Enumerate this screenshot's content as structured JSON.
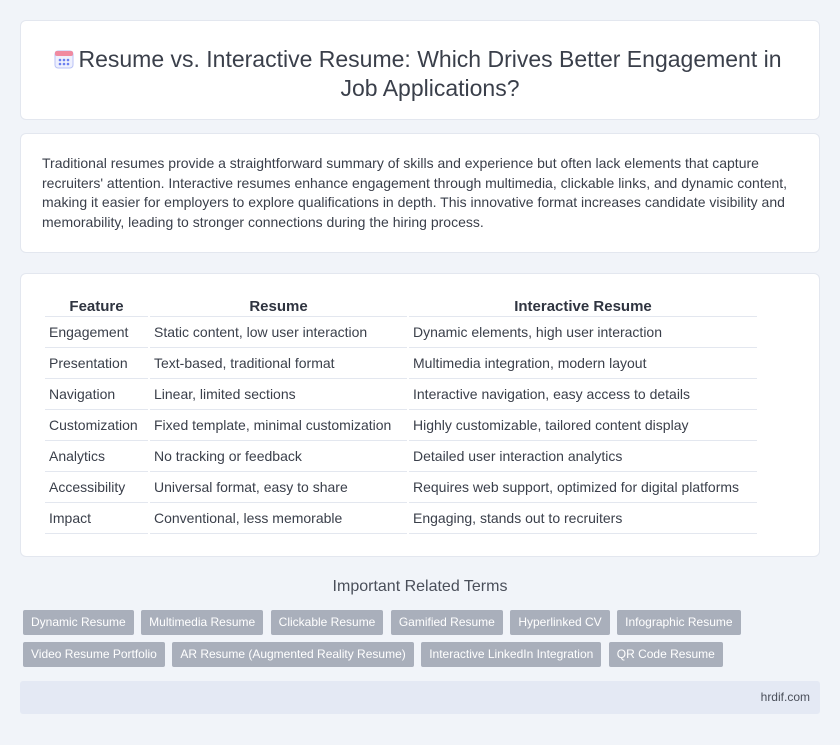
{
  "header": {
    "title": "Resume vs. Interactive Resume: Which Drives Better Engagement in Job Applications?",
    "icon": "calendar-icon"
  },
  "intro": {
    "text": "Traditional resumes provide a straightforward summary of skills and experience but often lack elements that capture recruiters' attention. Interactive resumes enhance engagement through multimedia, clickable links, and dynamic content, making it easier for employers to explore qualifications in depth. This innovative format increases candidate visibility and memorability, leading to stronger connections during the hiring process."
  },
  "table": {
    "headers": [
      "Feature",
      "Resume",
      "Interactive Resume"
    ],
    "rows": [
      [
        "Engagement",
        "Static content, low user interaction",
        "Dynamic elements, high user interaction"
      ],
      [
        "Presentation",
        "Text-based, traditional format",
        "Multimedia integration, modern layout"
      ],
      [
        "Navigation",
        "Linear, limited sections",
        "Interactive navigation, easy access to details"
      ],
      [
        "Customization",
        "Fixed template, minimal customization",
        "Highly customizable, tailored content display"
      ],
      [
        "Analytics",
        "No tracking or feedback",
        "Detailed user interaction analytics"
      ],
      [
        "Accessibility",
        "Universal format, easy to share",
        "Requires web support, optimized for digital platforms"
      ],
      [
        "Impact",
        "Conventional, less memorable",
        "Engaging, stands out to recruiters"
      ]
    ]
  },
  "related": {
    "title": "Important Related Terms",
    "tags": [
      "Dynamic Resume",
      "Multimedia Resume",
      "Clickable Resume",
      "Gamified Resume",
      "Hyperlinked CV",
      "Infographic Resume",
      "Video Resume Portfolio",
      "AR Resume (Augmented Reality Resume)",
      "Interactive LinkedIn Integration",
      "QR Code Resume"
    ]
  },
  "footer": {
    "site": "hrdif.com"
  },
  "colors": {
    "background": "#f1f4f9",
    "tag": "#a9afbb",
    "footer": "#e4e9f4",
    "icon_accent": "#6b7ff0"
  }
}
